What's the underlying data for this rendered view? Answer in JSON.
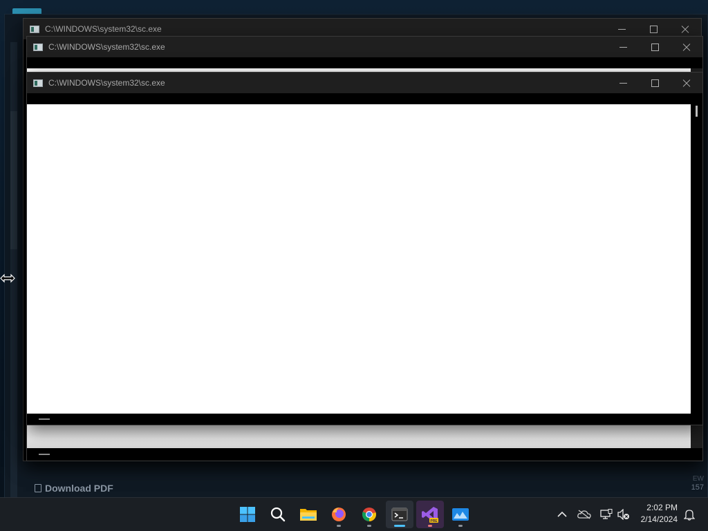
{
  "background_app": {
    "download_label": "Download PDF",
    "side_count": "157",
    "side_label": "EW"
  },
  "windows": [
    {
      "title": "C:\\WINDOWS\\system32\\sc.exe"
    },
    {
      "title": "C:\\WINDOWS\\system32\\sc.exe"
    },
    {
      "title": "C:\\WINDOWS\\system32\\sc.exe"
    }
  ],
  "taskbar": {
    "apps": [
      {
        "icon": "start-icon"
      },
      {
        "icon": "search-icon"
      },
      {
        "icon": "file-explorer-icon"
      },
      {
        "icon": "firefox-icon"
      },
      {
        "icon": "chrome-icon"
      },
      {
        "icon": "terminal-icon",
        "active": true
      },
      {
        "icon": "visual-studio-preview-icon",
        "badge": "PRE"
      },
      {
        "icon": "monitor-app-icon"
      }
    ],
    "tray_icons": [
      "chevron-up-icon",
      "onedrive-offline-icon",
      "network-icon",
      "volume-muted-icon"
    ],
    "time": "2:02 PM",
    "date": "2/14/2024",
    "notification_icon": "bell-icon"
  },
  "colors": {
    "accent": "#4cc2ff",
    "window_bg": "#1f1f1f",
    "taskbar_bg": "#1b1f24"
  }
}
